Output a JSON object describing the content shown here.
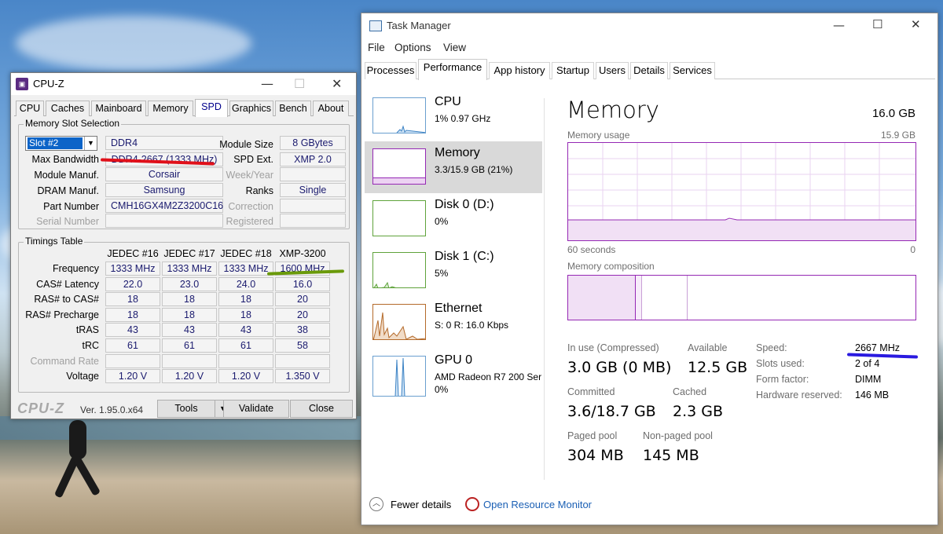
{
  "cpuz": {
    "title": "CPU-Z",
    "tabs": [
      "CPU",
      "Caches",
      "Mainboard",
      "Memory",
      "SPD",
      "Graphics",
      "Bench",
      "About"
    ],
    "active_tab": "SPD",
    "slot_group_label": "Memory Slot Selection",
    "slot_value": "Slot #2",
    "mem_type": "DDR4",
    "labels": {
      "max_bandwidth": "Max Bandwidth",
      "module_manuf": "Module Manuf.",
      "dram_manuf": "DRAM Manuf.",
      "part_number": "Part Number",
      "serial_number": "Serial Number",
      "module_size": "Module Size",
      "spd_ext": "SPD Ext.",
      "week_year": "Week/Year",
      "ranks": "Ranks",
      "correction": "Correction",
      "registered": "Registered"
    },
    "values": {
      "max_bandwidth": "DDR4-2667 (1333 MHz)",
      "module_manuf": "Corsair",
      "dram_manuf": "Samsung",
      "part_number": "CMH16GX4M2Z3200C16",
      "module_size": "8 GBytes",
      "spd_ext": "XMP 2.0",
      "ranks": "Single"
    },
    "timings_label": "Timings Table",
    "timing_headers": [
      "JEDEC #16",
      "JEDEC #17",
      "JEDEC #18",
      "XMP-3200"
    ],
    "timing_rows": [
      {
        "label": "Frequency",
        "values": [
          "1333 MHz",
          "1333 MHz",
          "1333 MHz",
          "1600 MHz"
        ],
        "dim": false
      },
      {
        "label": "CAS# Latency",
        "values": [
          "22.0",
          "23.0",
          "24.0",
          "16.0"
        ],
        "dim": false
      },
      {
        "label": "RAS# to CAS#",
        "values": [
          "18",
          "18",
          "18",
          "20"
        ],
        "dim": false
      },
      {
        "label": "RAS# Precharge",
        "values": [
          "18",
          "18",
          "18",
          "20"
        ],
        "dim": false
      },
      {
        "label": "tRAS",
        "values": [
          "43",
          "43",
          "43",
          "38"
        ],
        "dim": false
      },
      {
        "label": "tRC",
        "values": [
          "61",
          "61",
          "61",
          "58"
        ],
        "dim": false
      },
      {
        "label": "Command Rate",
        "values": [
          "",
          "",
          "",
          ""
        ],
        "dim": true
      },
      {
        "label": "Voltage",
        "values": [
          "1.20 V",
          "1.20 V",
          "1.20 V",
          "1.350 V"
        ],
        "dim": false
      }
    ],
    "brand": "CPU-Z",
    "version": "Ver. 1.95.0.x64",
    "tools_label": "Tools",
    "validate_label": "Validate",
    "close_label": "Close"
  },
  "tm": {
    "title": "Task Manager",
    "menu": [
      "File",
      "Options",
      "View"
    ],
    "tabs": [
      "Processes",
      "Performance",
      "App history",
      "Startup",
      "Users",
      "Details",
      "Services"
    ],
    "active_tab": "Performance",
    "side": [
      {
        "name": "CPU",
        "sub": "1% 0.97 GHz",
        "sub2": ""
      },
      {
        "name": "Memory",
        "sub": "3.3/15.9 GB (21%)",
        "sub2": ""
      },
      {
        "name": "Disk 0 (D:)",
        "sub": "0%",
        "sub2": ""
      },
      {
        "name": "Disk 1 (C:)",
        "sub": "5%",
        "sub2": ""
      },
      {
        "name": "Ethernet",
        "sub": "S: 0 R: 16.0 Kbps",
        "sub2": ""
      },
      {
        "name": "GPU 0",
        "sub": "AMD Radeon R7 200 Ser",
        "sub2": "0%"
      }
    ],
    "main_title": "Memory",
    "total": "16.0 GB",
    "usage_label": "Memory usage",
    "usage_max": "15.9 GB",
    "usage_level": 0.21,
    "axis_left": "60 seconds",
    "axis_right": "0",
    "composition_label": "Memory composition",
    "stats": {
      "in_use_label": "In use (Compressed)",
      "in_use": "3.0 GB (0 MB)",
      "available_label": "Available",
      "available": "12.5 GB",
      "committed_label": "Committed",
      "committed": "3.6/18.7 GB",
      "cached_label": "Cached",
      "cached": "2.3 GB",
      "paged_label": "Paged pool",
      "paged": "304 MB",
      "nonpaged_label": "Non-paged pool",
      "nonpaged": "145 MB"
    },
    "kv": [
      {
        "label": "Speed:",
        "value": "2667 MHz"
      },
      {
        "label": "Slots used:",
        "value": "2 of 4"
      },
      {
        "label": "Form factor:",
        "value": "DIMM"
      },
      {
        "label": "Hardware reserved:",
        "value": "146 MB"
      }
    ],
    "fewer_details": "Fewer details",
    "open_monitor": "Open Resource Monitor"
  }
}
